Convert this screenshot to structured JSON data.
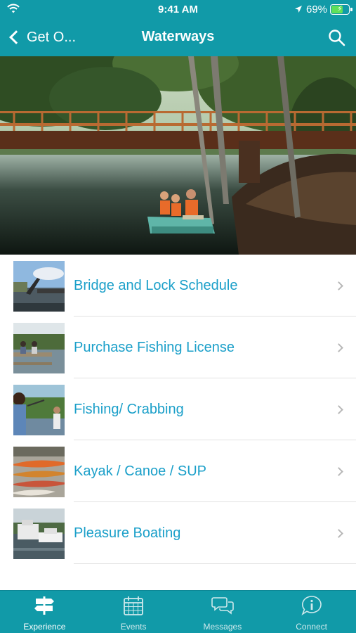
{
  "status_bar": {
    "time": "9:41 AM",
    "battery_percent": "69%",
    "battery_level": 0.69
  },
  "navbar": {
    "back_label": "Get O...",
    "title": "Waterways"
  },
  "list": {
    "items": [
      {
        "label": "Bridge and Lock Schedule"
      },
      {
        "label": "Purchase Fishing License"
      },
      {
        "label": "Fishing/ Crabbing"
      },
      {
        "label": "Kayak / Canoe / SUP"
      },
      {
        "label": "Pleasure Boating"
      }
    ]
  },
  "tabbar": {
    "tabs": [
      {
        "label": "Experience",
        "icon": "signpost-icon",
        "active": true
      },
      {
        "label": "Events",
        "icon": "calendar-icon",
        "active": false
      },
      {
        "label": "Messages",
        "icon": "chat-bubbles-icon",
        "active": false
      },
      {
        "label": "Connect",
        "icon": "info-bubble-icon",
        "active": false
      }
    ]
  },
  "colors": {
    "brand": "#119aa8",
    "link": "#1a9fc9",
    "chevron": "#b8b8b8"
  }
}
